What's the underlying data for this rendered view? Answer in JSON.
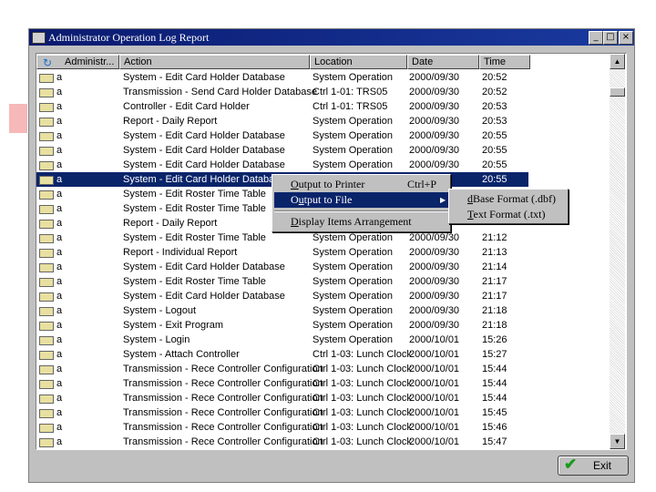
{
  "window": {
    "title": "Administrator Operation Log Report",
    "minimize": "_",
    "maximize": "□",
    "close": "×"
  },
  "columns": [
    "Administr...",
    "Action",
    "Location",
    "Date",
    "Time"
  ],
  "rows": [
    [
      "a",
      "System - Edit Card Holder Database",
      "System Operation",
      "2000/09/30",
      "20:52"
    ],
    [
      "a",
      "Transmission - Send Card Holder Database",
      "Ctrl 1-01: TRS05",
      "2000/09/30",
      "20:52"
    ],
    [
      "a",
      "Controller - Edit Card Holder",
      "Ctrl 1-01: TRS05",
      "2000/09/30",
      "20:53"
    ],
    [
      "a",
      "Report - Daily Report",
      "System Operation",
      "2000/09/30",
      "20:53"
    ],
    [
      "a",
      "System - Edit Card Holder Database",
      "System Operation",
      "2000/09/30",
      "20:55"
    ],
    [
      "a",
      "System - Edit Card Holder Database",
      "System Operation",
      "2000/09/30",
      "20:55"
    ],
    [
      "a",
      "System - Edit Card Holder Database",
      "System Operation",
      "2000/09/30",
      "20:55"
    ],
    [
      "a",
      "System - Edit Card Holder Database",
      "",
      "0",
      "20:55"
    ],
    [
      "a",
      "System - Edit Roster Time Table",
      "",
      "",
      ""
    ],
    [
      "a",
      "System - Edit Roster Time Table",
      "",
      "",
      ""
    ],
    [
      "a",
      "Report - Daily Report",
      "",
      "",
      ""
    ],
    [
      "a",
      "System - Edit Roster Time Table",
      "System Operation",
      "2000/09/30",
      "21:12"
    ],
    [
      "a",
      "Report - Individual Report",
      "System Operation",
      "2000/09/30",
      "21:13"
    ],
    [
      "a",
      "System - Edit Card Holder Database",
      "System Operation",
      "2000/09/30",
      "21:14"
    ],
    [
      "a",
      "System - Edit Roster Time Table",
      "System Operation",
      "2000/09/30",
      "21:17"
    ],
    [
      "a",
      "System - Edit Card Holder Database",
      "System Operation",
      "2000/09/30",
      "21:17"
    ],
    [
      "a",
      "System - Logout",
      "System Operation",
      "2000/09/30",
      "21:18"
    ],
    [
      "a",
      "System - Exit Program",
      "System Operation",
      "2000/09/30",
      "21:18"
    ],
    [
      "a",
      "System - Login",
      "System Operation",
      "2000/10/01",
      "15:26"
    ],
    [
      "a",
      "System - Attach Controller",
      "Ctrl 1-03: Lunch Clock",
      "2000/10/01",
      "15:27"
    ],
    [
      "a",
      "Transmission - Rece Controller Configuration",
      "Ctrl 1-03: Lunch Clock",
      "2000/10/01",
      "15:44"
    ],
    [
      "a",
      "Transmission - Rece Controller Configuration",
      "Ctrl 1-03: Lunch Clock",
      "2000/10/01",
      "15:44"
    ],
    [
      "a",
      "Transmission - Rece Controller Configuration",
      "Ctrl 1-03: Lunch Clock",
      "2000/10/01",
      "15:44"
    ],
    [
      "a",
      "Transmission - Rece Controller Configuration",
      "Ctrl 1-03: Lunch Clock",
      "2000/10/01",
      "15:45"
    ],
    [
      "a",
      "Transmission - Rece Controller Configuration",
      "Ctrl 1-03: Lunch Clock",
      "2000/10/01",
      "15:46"
    ],
    [
      "a",
      "Transmission - Rece Controller Configuration",
      "Ctrl 1-03: Lunch Clock",
      "2000/10/01",
      "15:47"
    ]
  ],
  "selected_row": 7,
  "context_menu": {
    "items": [
      {
        "first": "O",
        "rest": "utput to Printer",
        "shortcut": "Ctrl+P"
      },
      {
        "pre": "O",
        "u": "u",
        "rest": "tput to File",
        "arrow": "▶"
      },
      {
        "first": "D",
        "rest": "isplay Items Arrangement"
      }
    ]
  },
  "submenu": {
    "items": [
      {
        "first": "d",
        "rest": "Base Format (.dbf)"
      },
      {
        "first": "T",
        "rest": "ext Format (.txt)"
      }
    ]
  },
  "exit_button": {
    "label": "Exit",
    "icon": "checkmark-icon"
  },
  "colors": {
    "selection": "#0a246a",
    "title_bar": "#0a1a6e",
    "face": "#c0c0c0"
  }
}
